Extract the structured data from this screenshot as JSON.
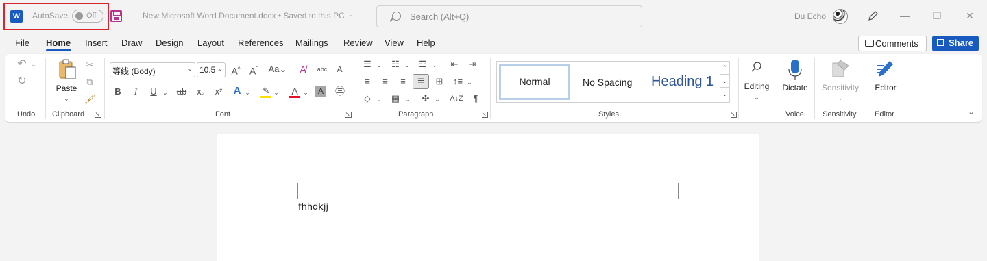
{
  "titlebar": {
    "app_logo": "W",
    "autosave_label": "AutoSave",
    "autosave_state": "Off",
    "document_title": "New Microsoft Word Document.docx • Saved to this PC",
    "search_placeholder": "Search (Alt+Q)",
    "user_name": "Du Echo",
    "window_controls": [
      "minimize-icon",
      "restore-icon",
      "close-icon"
    ]
  },
  "menu": {
    "tabs": [
      "File",
      "Home",
      "Insert",
      "Draw",
      "Design",
      "Layout",
      "References",
      "Mailings",
      "Review",
      "View",
      "Help"
    ],
    "active_tab": "Home",
    "comments_label": "Comments",
    "share_label": "Share"
  },
  "ribbon": {
    "groups": {
      "undo": "Undo",
      "clipboard": "Clipboard",
      "font": "Font",
      "paragraph": "Paragraph",
      "styles": "Styles",
      "voice": "Voice",
      "sensitivity": "Sensitivity",
      "editor": "Editor"
    },
    "paste_label": "Paste",
    "font_name": "等线 (Body)",
    "font_size": "10.5",
    "styles": {
      "normal": "Normal",
      "no_spacing": "No Spacing",
      "heading1": "Heading 1"
    },
    "editing_label": "Editing",
    "dictate_label": "Dictate",
    "sensitivity_label": "Sensitivity",
    "editor_label": "Editor",
    "font_buttons": [
      "B",
      "I",
      "U",
      "ab",
      "x₂",
      "x²",
      "A",
      "Aa",
      "A"
    ],
    "paragraph_mark": "¶"
  },
  "document": {
    "text": "fhhdkjj"
  },
  "colors": {
    "accent": "#185abd",
    "highlight_border": "#d6252b",
    "save_icon": "#b4338e"
  }
}
